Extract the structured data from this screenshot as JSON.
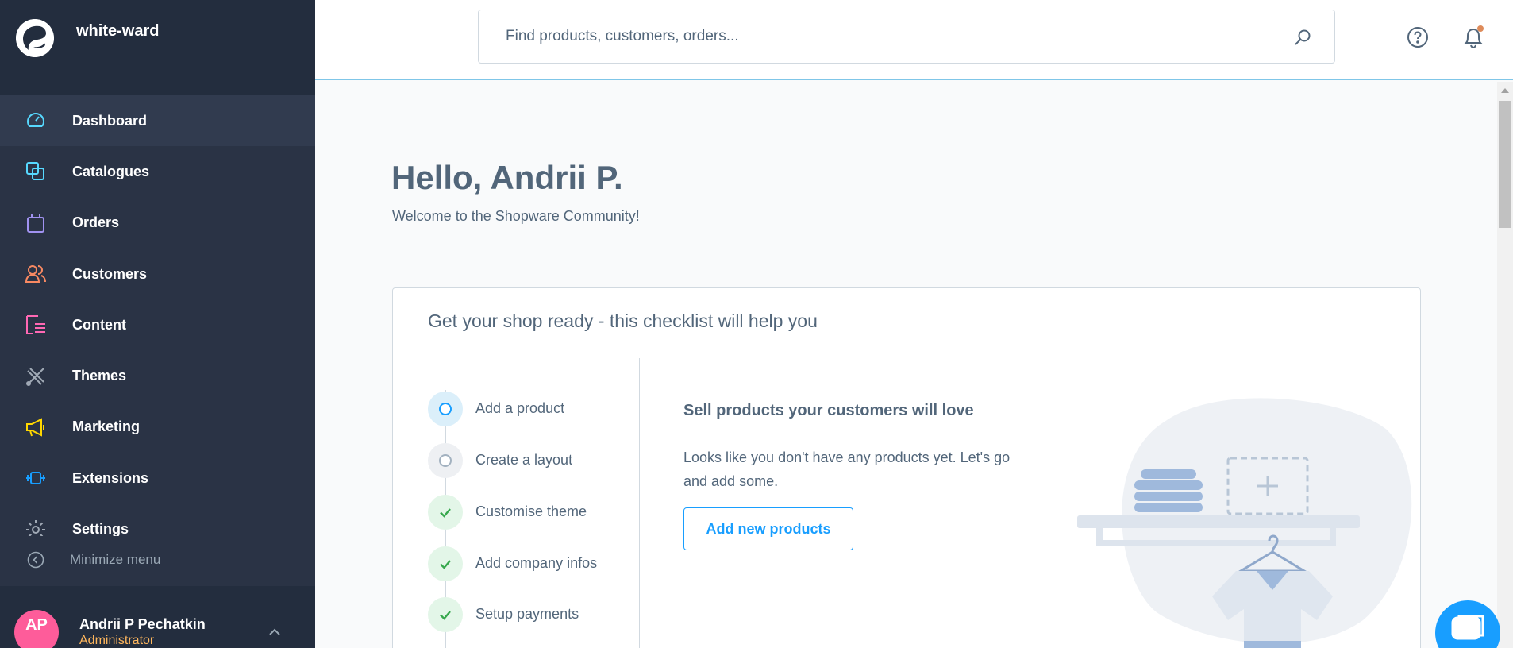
{
  "sidebar": {
    "shop_name": "white-ward",
    "items": [
      {
        "label": "Dashboard",
        "icon": "dashboard-icon",
        "color": "#57d9ff"
      },
      {
        "label": "Catalogues",
        "icon": "catalogues-icon",
        "color": "#57d9ff"
      },
      {
        "label": "Orders",
        "icon": "orders-icon",
        "color": "#a092f0"
      },
      {
        "label": "Customers",
        "icon": "customers-icon",
        "color": "#f88962"
      },
      {
        "label": "Content",
        "icon": "content-icon",
        "color": "#ff68b4"
      },
      {
        "label": "Themes",
        "icon": "themes-icon",
        "color": "#a0a9b5"
      },
      {
        "label": "Marketing",
        "icon": "marketing-icon",
        "color": "#ffd700"
      },
      {
        "label": "Extensions",
        "icon": "extensions-icon",
        "color": "#189eff"
      },
      {
        "label": "Settings",
        "icon": "settings-icon",
        "color": "#a0a9b5"
      }
    ],
    "minimize_label": "Minimize menu",
    "user": {
      "initials": "AP",
      "name": "Andrii P Pechatkin",
      "role": "Administrator"
    }
  },
  "header": {
    "search_placeholder": "Find products, customers, orders..."
  },
  "main": {
    "greeting": "Hello, Andrii P.",
    "welcome": "Welcome to the Shopware Community!",
    "checklist": {
      "title": "Get your shop ready - this checklist will help you",
      "steps": [
        {
          "label": "Add a product",
          "status": "current"
        },
        {
          "label": "Create a layout",
          "status": "todo"
        },
        {
          "label": "Customise theme",
          "status": "done"
        },
        {
          "label": "Add company infos",
          "status": "done"
        },
        {
          "label": "Setup payments",
          "status": "done"
        }
      ],
      "detail_title": "Sell products your customers will love",
      "detail_text": "Looks like you don't have any products yet. Let's go and add some.",
      "button_label": "Add new products"
    }
  },
  "colors": {
    "sidebar_bg": "#2a3345",
    "accent": "#189eff",
    "success": "#37d046",
    "admin_role": "#ffb75d",
    "avatar": "#fe5c9a"
  }
}
